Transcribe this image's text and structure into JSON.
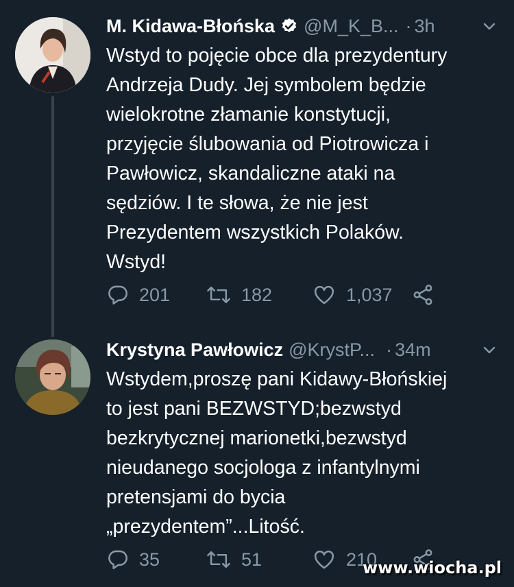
{
  "tweets": [
    {
      "name": "M. Kidawa-Błońska",
      "verified": true,
      "handle": "@M_K_B...",
      "dot": "·",
      "time": "3h",
      "text": "Wstyd to pojęcie obce dla prezydentury\nAndrzeja Dudy. Jej symbolem będzie\nwielokrotne złamanie konstytucji,\nprzyjęcie ślubowania od Piotrowicza i\nPawłowicz, skandaliczne ataki na\nsędziów. I te słowa, że nie jest\nPrezydentem wszystkich Polaków.\nWstyd!",
      "replies": "201",
      "retweets": "182",
      "likes": "1,037"
    },
    {
      "name": "Krystyna Pawłowicz",
      "verified": false,
      "handle": "@KrystP...",
      "dot": "·",
      "time": "34m",
      "text": "Wstydem,proszę pani Kidawy-Błońskiej\nto jest pani BEZWSTYD;bezwstyd\nbezkrytycznej marionetki,bezwstyd\nnieudanego socjologa z infantylnymi\npretensjami do bycia\n„prezydentem”...Litość.",
      "replies": "35",
      "retweets": "51",
      "likes": "210"
    }
  ],
  "watermark": "www.wiocha.pl",
  "colors": {
    "background": "#15202b",
    "secondary_text": "#8899a6",
    "thread_line": "#38444d"
  }
}
